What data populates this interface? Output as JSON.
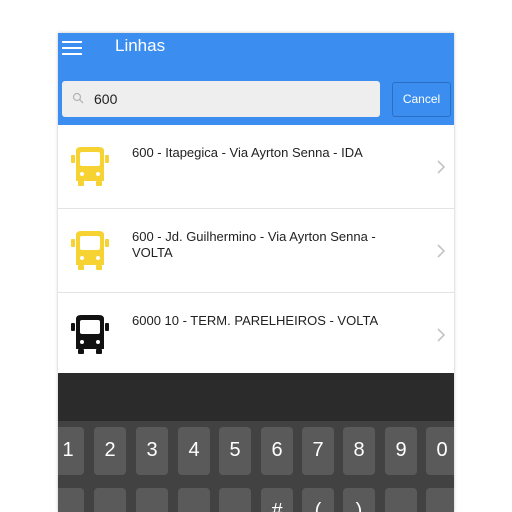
{
  "header": {
    "title": "Linhas"
  },
  "search": {
    "value": "600",
    "placeholder": "",
    "cancel_label": "Cancel"
  },
  "colors": {
    "accent": "#3b8ef0",
    "bus_yellow": "#f6d232",
    "bus_black": "#111111"
  },
  "routes": [
    {
      "label": "600 - Itapegica - Via Ayrton Senna - IDA",
      "icon": "bus-yellow-icon"
    },
    {
      "label": "600 - Jd. Guilhermino - Via Ayrton Senna - VOLTA",
      "icon": "bus-yellow-icon"
    },
    {
      "label": "6000 10 - TERM. PARELHEIROS - VOLTA",
      "icon": "bus-black-icon"
    }
  ],
  "keyboard": {
    "number_row": [
      "1",
      "2",
      "3",
      "4",
      "5",
      "6",
      "7",
      "8",
      "9",
      "0"
    ],
    "second_row_partial": [
      "@",
      "#",
      "(",
      ")"
    ]
  }
}
